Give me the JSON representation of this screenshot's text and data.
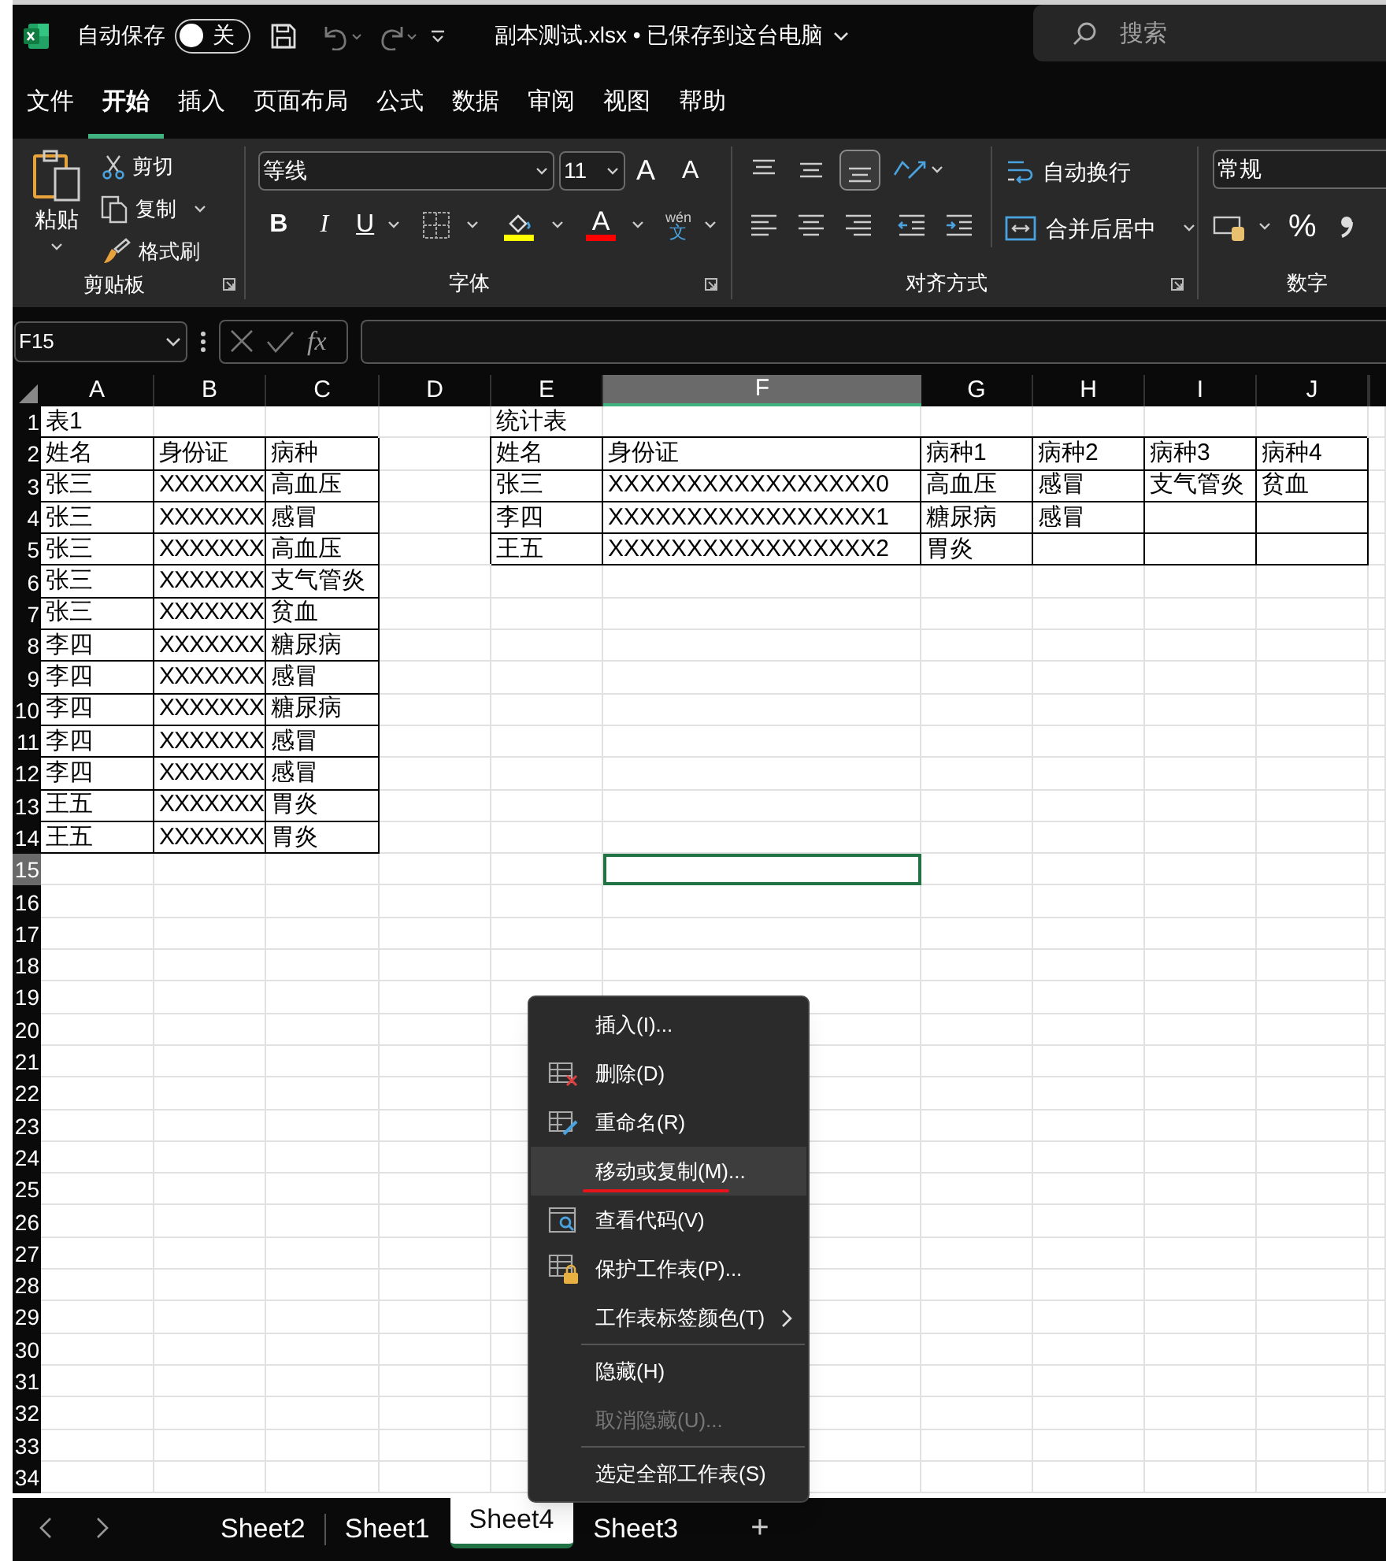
{
  "title_bar": {
    "autosave_label": "自动保存",
    "autosave": {
      "on": false,
      "label": "关"
    },
    "file_title": "副本测试.xlsx • 已保存到这台电脑",
    "search_placeholder": "搜索"
  },
  "ribbon_tabs": [
    {
      "label": "文件",
      "selected": false
    },
    {
      "label": "开始",
      "selected": true
    },
    {
      "label": "插入",
      "selected": false
    },
    {
      "label": "页面布局",
      "selected": false
    },
    {
      "label": "公式",
      "selected": false
    },
    {
      "label": "数据",
      "selected": false
    },
    {
      "label": "审阅",
      "selected": false
    },
    {
      "label": "视图",
      "selected": false
    },
    {
      "label": "帮助",
      "selected": false
    }
  ],
  "ribbon": {
    "clipboard": {
      "paste": "粘贴",
      "cut": "剪切",
      "copy": "复制",
      "format_painter": "格式刷",
      "group_label": "剪贴板"
    },
    "font": {
      "font_name": "等线",
      "font_size": "11",
      "grow": "A",
      "shrink": "A",
      "bold": "B",
      "italic": "I",
      "underline": "U",
      "font_color": "A",
      "phonetic": "wén",
      "phonetic_char": "文",
      "group_label": "字体"
    },
    "alignment": {
      "wrap_text": "自动换行",
      "merge_center": "合并后居中",
      "group_label": "对齐方式"
    },
    "number": {
      "format": "常规",
      "percent": "%",
      "group_label": "数字"
    }
  },
  "formula_bar": {
    "name_box": "F15",
    "fx": "fx"
  },
  "sheet": {
    "columns": [
      {
        "label": "A",
        "selected": false
      },
      {
        "label": "B",
        "selected": false
      },
      {
        "label": "C",
        "selected": false
      },
      {
        "label": "D",
        "selected": false
      },
      {
        "label": "E",
        "selected": false
      },
      {
        "label": "F",
        "selected": true
      },
      {
        "label": "G",
        "selected": false
      },
      {
        "label": "H",
        "selected": false
      },
      {
        "label": "I",
        "selected": false
      },
      {
        "label": "J",
        "selected": false
      }
    ],
    "rows": [
      {
        "label": "1",
        "selected": false,
        "cells": [
          {
            "text": "表1",
            "bordered": false,
            "selected": false
          },
          {
            "bordered": false,
            "selected": false
          },
          {
            "bordered": false,
            "selected": false
          },
          {
            "bordered": false,
            "selected": false
          },
          {
            "text": "统计表",
            "bordered": false,
            "selected": false
          },
          {
            "bordered": false,
            "selected": false
          },
          {
            "bordered": false,
            "selected": false
          },
          {
            "bordered": false,
            "selected": false
          },
          {
            "bordered": false,
            "selected": false
          },
          {
            "bordered": false,
            "selected": false
          }
        ]
      },
      {
        "label": "2",
        "selected": false,
        "cells": [
          {
            "text": "姓名",
            "bordered": true,
            "selected": false
          },
          {
            "text": "身份证",
            "bordered": true,
            "selected": false
          },
          {
            "text": "病种",
            "bordered": true,
            "selected": false
          },
          {
            "bordered": false,
            "selected": false
          },
          {
            "text": "姓名",
            "bordered": true,
            "selected": false
          },
          {
            "text": "身份证",
            "bordered": true,
            "selected": false
          },
          {
            "text": "病种1",
            "bordered": true,
            "selected": false
          },
          {
            "text": "病种2",
            "bordered": true,
            "selected": false
          },
          {
            "text": "病种3",
            "bordered": true,
            "selected": false
          },
          {
            "text": "病种4",
            "bordered": true,
            "selected": false
          }
        ]
      },
      {
        "label": "3",
        "selected": false,
        "cells": [
          {
            "text": "张三",
            "bordered": true,
            "selected": false
          },
          {
            "text": "XXXXXXX",
            "bordered": true,
            "selected": false
          },
          {
            "text": "高血压",
            "bordered": true,
            "selected": false
          },
          {
            "bordered": false,
            "selected": false
          },
          {
            "text": "张三",
            "bordered": true,
            "selected": false
          },
          {
            "text": "XXXXXXXXXXXXXXXXX0",
            "bordered": true,
            "selected": false
          },
          {
            "text": "高血压",
            "bordered": true,
            "selected": false
          },
          {
            "text": "感冒",
            "bordered": true,
            "selected": false
          },
          {
            "text": "支气管炎",
            "bordered": true,
            "selected": false
          },
          {
            "text": "贫血",
            "bordered": true,
            "selected": false
          }
        ]
      },
      {
        "label": "4",
        "selected": false,
        "cells": [
          {
            "text": "张三",
            "bordered": true,
            "selected": false
          },
          {
            "text": "XXXXXXX",
            "bordered": true,
            "selected": false
          },
          {
            "text": "感冒",
            "bordered": true,
            "selected": false
          },
          {
            "bordered": false,
            "selected": false
          },
          {
            "text": "李四",
            "bordered": true,
            "selected": false
          },
          {
            "text": "XXXXXXXXXXXXXXXXX1",
            "bordered": true,
            "selected": false
          },
          {
            "text": "糖尿病",
            "bordered": true,
            "selected": false
          },
          {
            "text": "感冒",
            "bordered": true,
            "selected": false
          },
          {
            "bordered": true,
            "selected": false
          },
          {
            "bordered": true,
            "selected": false
          }
        ]
      },
      {
        "label": "5",
        "selected": false,
        "cells": [
          {
            "text": "张三",
            "bordered": true,
            "selected": false
          },
          {
            "text": "XXXXXXX",
            "bordered": true,
            "selected": false
          },
          {
            "text": "高血压",
            "bordered": true,
            "selected": false
          },
          {
            "bordered": false,
            "selected": false
          },
          {
            "text": "王五",
            "bordered": true,
            "selected": false
          },
          {
            "text": "XXXXXXXXXXXXXXXXX2",
            "bordered": true,
            "selected": false
          },
          {
            "text": "胃炎",
            "bordered": true,
            "selected": false
          },
          {
            "bordered": true,
            "selected": false
          },
          {
            "bordered": true,
            "selected": false
          },
          {
            "bordered": true,
            "selected": false
          }
        ]
      },
      {
        "label": "6",
        "selected": false,
        "cells": [
          {
            "text": "张三",
            "bordered": true,
            "selected": false
          },
          {
            "text": "XXXXXXX",
            "bordered": true,
            "selected": false
          },
          {
            "text": "支气管炎",
            "bordered": true,
            "selected": false
          }
        ]
      },
      {
        "label": "7",
        "selected": false,
        "cells": [
          {
            "text": "张三",
            "bordered": true,
            "selected": false
          },
          {
            "text": "XXXXXXX",
            "bordered": true,
            "selected": false
          },
          {
            "text": "贫血",
            "bordered": true,
            "selected": false
          }
        ]
      },
      {
        "label": "8",
        "selected": false,
        "cells": [
          {
            "text": "李四",
            "bordered": true,
            "selected": false
          },
          {
            "text": "XXXXXXX",
            "bordered": true,
            "selected": false
          },
          {
            "text": "糖尿病",
            "bordered": true,
            "selected": false
          }
        ]
      },
      {
        "label": "9",
        "selected": false,
        "cells": [
          {
            "text": "李四",
            "bordered": true,
            "selected": false
          },
          {
            "text": "XXXXXXX",
            "bordered": true,
            "selected": false
          },
          {
            "text": "感冒",
            "bordered": true,
            "selected": false
          }
        ]
      },
      {
        "label": "10",
        "selected": false,
        "cells": [
          {
            "text": "李四",
            "bordered": true,
            "selected": false
          },
          {
            "text": "XXXXXXX",
            "bordered": true,
            "selected": false
          },
          {
            "text": "糖尿病",
            "bordered": true,
            "selected": false
          }
        ]
      },
      {
        "label": "11",
        "selected": false,
        "cells": [
          {
            "text": "李四",
            "bordered": true,
            "selected": false
          },
          {
            "text": "XXXXXXX",
            "bordered": true,
            "selected": false
          },
          {
            "text": "感冒",
            "bordered": true,
            "selected": false
          }
        ]
      },
      {
        "label": "12",
        "selected": false,
        "cells": [
          {
            "text": "李四",
            "bordered": true,
            "selected": false
          },
          {
            "text": "XXXXXXX",
            "bordered": true,
            "selected": false
          },
          {
            "text": "感冒",
            "bordered": true,
            "selected": false
          }
        ]
      },
      {
        "label": "13",
        "selected": false,
        "cells": [
          {
            "text": "王五",
            "bordered": true,
            "selected": false
          },
          {
            "text": "XXXXXXX",
            "bordered": true,
            "selected": false
          },
          {
            "text": "胃炎",
            "bordered": true,
            "selected": false
          }
        ]
      },
      {
        "label": "14",
        "selected": false,
        "cells": [
          {
            "text": "王五",
            "bordered": true,
            "selected": false
          },
          {
            "text": "XXXXXXX",
            "bordered": true,
            "selected": false
          },
          {
            "text": "胃炎",
            "bordered": true,
            "selected": false
          }
        ]
      },
      {
        "label": "15",
        "selected": true,
        "cells": [
          {
            "bordered": false,
            "selected": false
          },
          {
            "bordered": false,
            "selected": false
          },
          {
            "bordered": false,
            "selected": false
          },
          {
            "bordered": false,
            "selected": false
          },
          {
            "bordered": false,
            "selected": false
          },
          {
            "bordered": false,
            "selected": true
          }
        ]
      },
      {
        "label": "16",
        "selected": false
      },
      {
        "label": "17",
        "selected": false
      },
      {
        "label": "18",
        "selected": false
      },
      {
        "label": "19",
        "selected": false
      },
      {
        "label": "20",
        "selected": false
      },
      {
        "label": "21",
        "selected": false
      },
      {
        "label": "22",
        "selected": false
      },
      {
        "label": "23",
        "selected": false
      },
      {
        "label": "24",
        "selected": false
      },
      {
        "label": "25",
        "selected": false
      },
      {
        "label": "26",
        "selected": false
      },
      {
        "label": "27",
        "selected": false
      },
      {
        "label": "28",
        "selected": false
      },
      {
        "label": "29",
        "selected": false
      },
      {
        "label": "30",
        "selected": false
      },
      {
        "label": "31",
        "selected": false
      },
      {
        "label": "32",
        "selected": false
      },
      {
        "label": "33",
        "selected": false
      },
      {
        "label": "34",
        "selected": false
      }
    ]
  },
  "sheet_tabs": [
    {
      "label": "Sheet2",
      "selected": false
    },
    {
      "label": "Sheet1",
      "selected": false
    },
    {
      "label": "Sheet4",
      "selected": true
    },
    {
      "label": "Sheet3",
      "selected": false
    }
  ],
  "new_sheet": "+",
  "context_menu": [
    {
      "kind": "item",
      "label": "插入(I)...",
      "disabled": false,
      "selected": false,
      "submenu": false,
      "marked": false
    },
    {
      "kind": "item",
      "label": "删除(D)",
      "disabled": false,
      "selected": false,
      "submenu": false,
      "marked": false
    },
    {
      "kind": "item",
      "label": "重命名(R)",
      "disabled": false,
      "selected": false,
      "submenu": false,
      "marked": false
    },
    {
      "kind": "item",
      "label": "移动或复制(M)...",
      "disabled": false,
      "selected": true,
      "submenu": false,
      "marked": true
    },
    {
      "kind": "item",
      "label": "查看代码(V)",
      "disabled": false,
      "selected": false,
      "submenu": false,
      "marked": false
    },
    {
      "kind": "item",
      "label": "保护工作表(P)...",
      "disabled": false,
      "selected": false,
      "submenu": false,
      "marked": false
    },
    {
      "kind": "item",
      "label": "工作表标签颜色(T)",
      "disabled": false,
      "selected": false,
      "submenu": true,
      "marked": false
    },
    {
      "kind": "separator"
    },
    {
      "kind": "item",
      "label": "隐藏(H)",
      "disabled": false,
      "selected": false,
      "submenu": false,
      "marked": false
    },
    {
      "kind": "item",
      "label": "取消隐藏(U)...",
      "disabled": true,
      "selected": false,
      "submenu": false,
      "marked": false
    },
    {
      "kind": "separator"
    },
    {
      "kind": "item",
      "label": "选定全部工作表(S)",
      "disabled": false,
      "selected": false,
      "submenu": false,
      "marked": false
    }
  ]
}
